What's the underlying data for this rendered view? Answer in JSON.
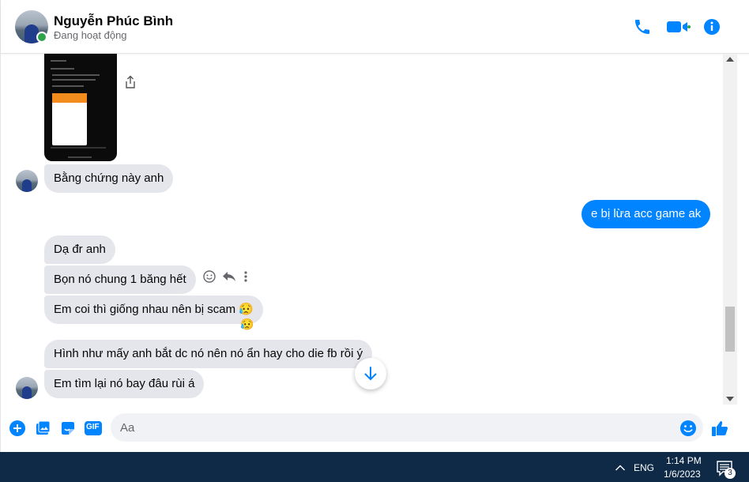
{
  "contact": {
    "name": "Nguyễn Phúc Bình",
    "status": "Đang hoạt động"
  },
  "header_icons": [
    "phone-icon",
    "video-call-icon",
    "info-icon"
  ],
  "messages": [
    {
      "from": "contact",
      "type": "image"
    },
    {
      "from": "contact",
      "text": "Bằng chứng này anh"
    },
    {
      "from": "me",
      "text": "e bị lừa acc game ak"
    },
    {
      "from": "contact",
      "text": "Dạ đr anh"
    },
    {
      "from": "contact",
      "text": "Bọn nó chung 1 băng hết"
    },
    {
      "from": "contact",
      "text": "Em coi thì giống nhau nên bị scam 😥"
    },
    {
      "from": "contact",
      "text": "Hình như mấy anh bắt dc nó nên nó ẩn hay cho die fb rồi ý"
    },
    {
      "from": "contact",
      "text": "Em tìm lại nó bay đâu rùi á"
    }
  ],
  "reaction": "😥",
  "composer": {
    "placeholder": "Aa",
    "gif_label": "GIF"
  },
  "taskbar": {
    "language": "ENG",
    "time": "1:14 PM",
    "date": "1/6/2023",
    "notification_count": "3"
  },
  "colors": {
    "accent": "#0084ff",
    "incoming_bubble": "#e4e6eb",
    "online": "#31a24c",
    "taskbar": "#0e2a47"
  }
}
